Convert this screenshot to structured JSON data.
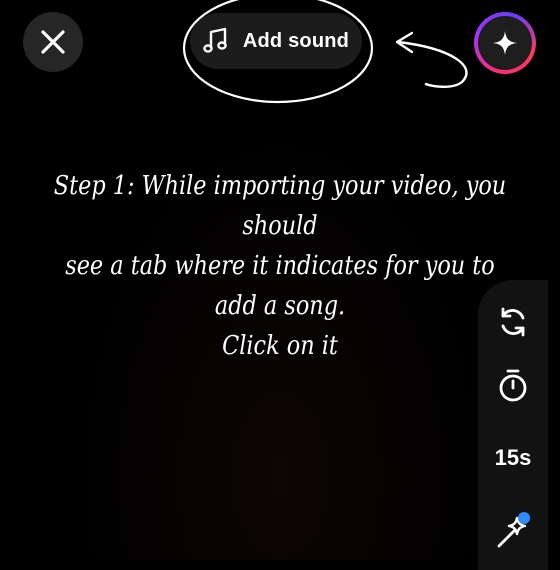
{
  "toolbar": {
    "close_icon": "close-icon",
    "add_sound_label": "Add sound",
    "music_icon": "music-note-icon",
    "sparkle_icon": "sparkle-icon"
  },
  "caption": {
    "line1": "Step 1: While importing your video, you should",
    "line2": "see a tab where it indicates for you to add a song.",
    "line3": "Click on it"
  },
  "side_controls": {
    "flip_icon": "flip-camera-icon",
    "timer_icon": "stopwatch-icon",
    "duration_label": "15s",
    "effects_icon": "sparkles-effects-icon"
  },
  "colors": {
    "background": "#000000",
    "button_bg": "#262626",
    "sparkle_ring": "#ff2d78",
    "badge_dot": "#2f8cff"
  }
}
